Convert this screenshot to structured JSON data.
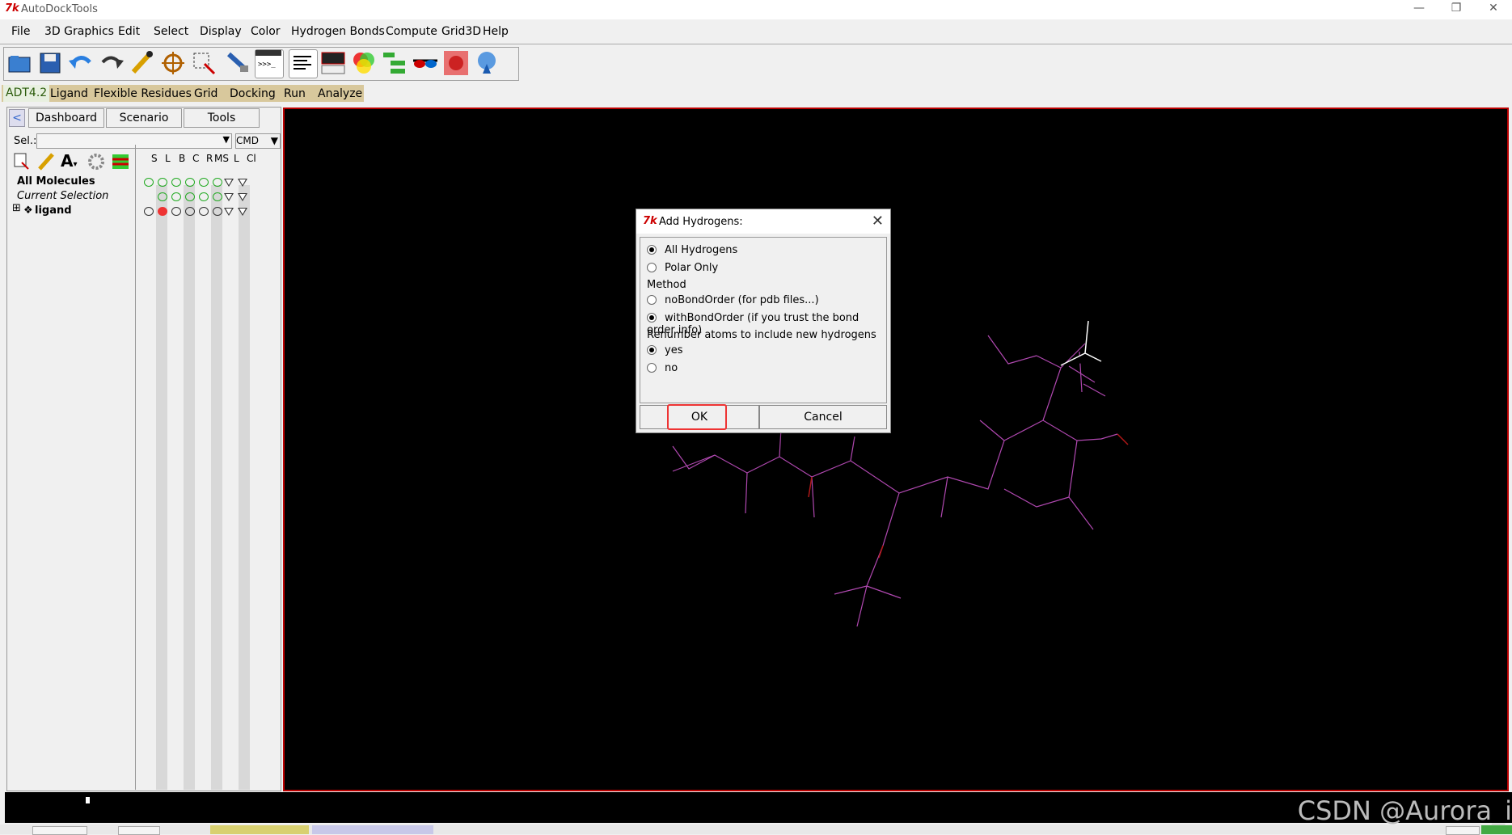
{
  "window": {
    "app_title": "AutoDockTools",
    "tk_logo": "7k",
    "controls": [
      "—",
      "❐",
      "✕"
    ]
  },
  "menubar": {
    "items": [
      "File",
      "3D Graphics",
      "Edit",
      "Select",
      "Display",
      "Color",
      "Hydrogen Bonds",
      "Compute",
      "Grid3D",
      "Help"
    ]
  },
  "adt_menu": {
    "items": [
      "ADT4.2",
      "Ligand",
      "Flexible Residues",
      "Grid",
      "Docking",
      "Run",
      "Analyze"
    ]
  },
  "dashboard": {
    "tabs": [
      "Dashboard",
      "Scenario",
      "Tools"
    ],
    "sel_label": "Sel.:",
    "cmd_label": "CMD",
    "columns": [
      "S",
      "L",
      "B",
      "C",
      "R",
      "MS",
      "L",
      "Cl"
    ],
    "rows": [
      {
        "label": "All Molecules",
        "style": "bold"
      },
      {
        "label": "Current Selection",
        "style": "italic"
      },
      {
        "label": "ligand",
        "style": "bold"
      }
    ],
    "expand_symbol": "⊞"
  },
  "dialog": {
    "title": "Add Hydrogens:",
    "close": "✕",
    "options": {
      "all_hydrogens": "All Hydrogens",
      "polar_only": "Polar Only",
      "method_label": "Method",
      "no_bond_order": "noBondOrder (for pdb files...)",
      "with_bond_order": "withBondOrder (if you trust the bond order info)",
      "renumber_label": "Renumber atoms to include new hydrogens",
      "yes": "yes",
      "no": "no"
    },
    "selected": {
      "hydrogens": "All Hydrogens",
      "method": "withBondOrder",
      "renumber": "yes"
    },
    "ok_label": "OK",
    "cancel_label": "Cancel"
  },
  "watermark": "CSDN @Aurora_i",
  "colors": {
    "accent_highlight": "#e33333",
    "viewer_border": "#bb0000",
    "molecule": "#c050c0"
  }
}
